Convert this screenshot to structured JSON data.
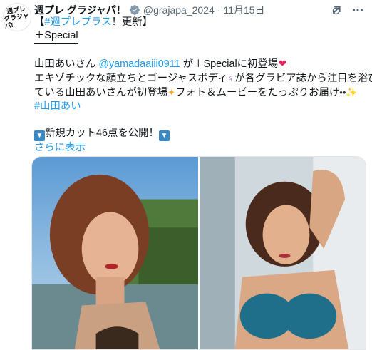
{
  "avatar": {
    "lines": [
      "週プレ",
      "グラジャパ!"
    ]
  },
  "header": {
    "name": "週プレ グラジャパ！",
    "handle": "@grajapa_2024",
    "dot": "·",
    "date": "11月15日"
  },
  "post": {
    "line1_prefix": "【",
    "line1_hashtag": "#週プレプラス",
    "line1_suffix": "！更新】",
    "line2": "＋Special",
    "line3_a": "山田あいさん ",
    "line3_mention": "@yamadaaiii0911",
    "line3_b": " が＋Specialに初登場",
    "line4": "エキゾチックな顔立ちとゴージャスボディ",
    "line4_b": "が各グラビア誌から注目を浴び",
    "line5_a": "ている山田あいさんが初登場",
    "line5_b": "フォト＆ムービーをたっぷりお届け",
    "line6_hashtag": "#山田あい",
    "line7": "新規カット46点を公開！",
    "show_more": "さらに表示"
  },
  "icons": [
    "verified-badge",
    "grok-icon",
    "more-icon",
    "heart-emoji",
    "ring-emoji",
    "dizzy-emoji",
    "eyes-emoji",
    "sparkles-emoji",
    "down-arrow-emoji"
  ],
  "colors": {
    "link": "#1d9bf0",
    "text": "#0f1419",
    "secondary": "#536471"
  }
}
